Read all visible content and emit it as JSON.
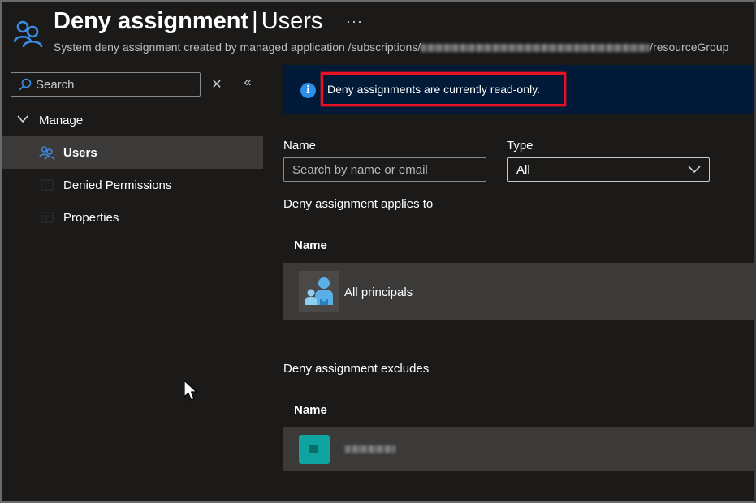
{
  "header": {
    "title_bold": "Deny assignment",
    "title_separator": "|",
    "title_thin": "Users",
    "more_label": "···",
    "subtitle_prefix": "System deny assignment created by managed application /subscriptions/",
    "subtitle_suffix": "/resourceGroup"
  },
  "sidebar": {
    "search": {
      "placeholder": "Search"
    },
    "clear_label": "✕",
    "collapse_label": "«",
    "group": {
      "label": "Manage"
    },
    "items": [
      {
        "label": "Users",
        "icon": "users-icon",
        "active": true
      },
      {
        "label": "Denied Permissions",
        "icon": "permissions-icon",
        "active": false
      },
      {
        "label": "Properties",
        "icon": "properties-icon",
        "active": false
      }
    ]
  },
  "main": {
    "banner": {
      "text": "Deny assignments are currently read-only.",
      "info_glyph": "i"
    },
    "filters": {
      "name_label": "Name",
      "name_placeholder": "Search by name or email",
      "type_label": "Type",
      "type_value": "All"
    },
    "applies_to": {
      "title": "Deny assignment applies to",
      "column_header": "Name",
      "rows": [
        {
          "label": "All principals",
          "icon": "all-principals-icon"
        }
      ]
    },
    "excludes": {
      "title": "Deny assignment excludes",
      "column_header": "Name",
      "rows": [
        {
          "label": "",
          "icon": "managed-app-icon",
          "redacted": true
        }
      ]
    }
  },
  "colors": {
    "background": "#1b1a19",
    "selected": "#3b3a39",
    "banner": "#001a38",
    "highlight_border": "#e81123",
    "accent_blue": "#2b8ee8",
    "teal": "#0fa4a0"
  }
}
